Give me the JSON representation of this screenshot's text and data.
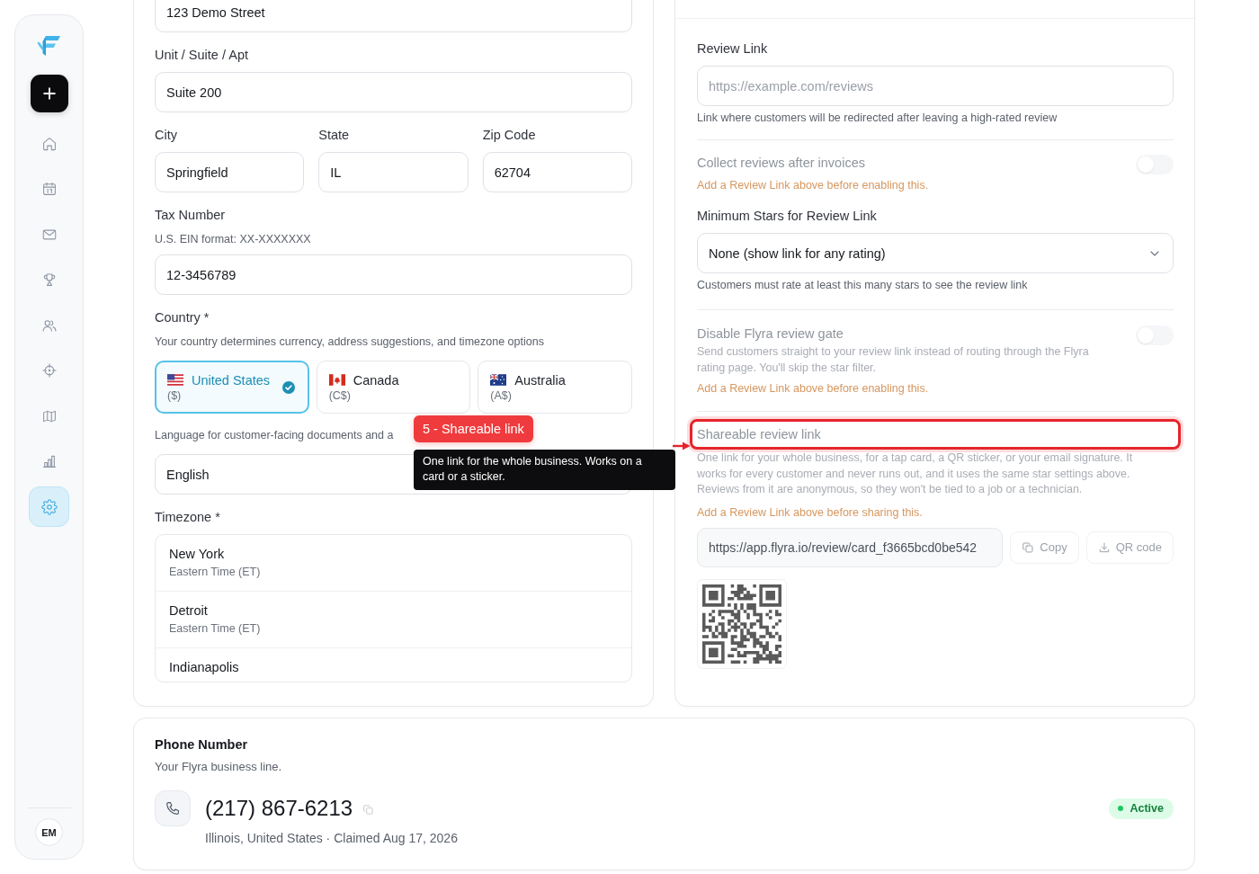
{
  "sidebar": {
    "nav": [
      {
        "selected": false
      },
      {
        "selected": false
      },
      {
        "selected": false
      },
      {
        "selected": false
      },
      {
        "selected": false
      },
      {
        "selected": false
      },
      {
        "selected": false
      },
      {
        "selected": false
      },
      {
        "selected": true
      }
    ],
    "user_initials": "EM"
  },
  "business_details": {
    "street": {
      "value": "123 Demo Street"
    },
    "unit": {
      "label": "Unit / Suite / Apt",
      "value": "Suite 200"
    },
    "address": [
      {
        "label": "City",
        "value": "Springfield"
      },
      {
        "label": "State",
        "value": "IL"
      },
      {
        "label": "Zip Code",
        "value": "62704"
      }
    ],
    "tax_number": {
      "label": "Tax Number",
      "hint": "U.S. EIN format: XX-XXXXXXX",
      "value": "12-3456789"
    },
    "country": {
      "label": "Country *",
      "hint": "Your country determines currency, address suggestions, and timezone options",
      "options": [
        {
          "name": "United States",
          "currency": "($)",
          "selected": true
        },
        {
          "name": "Canada",
          "currency": "(C$)",
          "selected": false
        },
        {
          "name": "Australia",
          "currency": "(A$)",
          "selected": false
        }
      ]
    },
    "language": {
      "hint": "Language for customer-facing documents and a",
      "value": "English"
    },
    "timezone": {
      "label": "Timezone *",
      "options": [
        {
          "city": "New York",
          "zone": "Eastern Time (ET)",
          "selected": false
        },
        {
          "city": "Detroit",
          "zone": "Eastern Time (ET)",
          "selected": false
        },
        {
          "city": "Indianapolis",
          "selected": false
        }
      ]
    }
  },
  "review_settings": {
    "review_link": {
      "label": "Review Link",
      "placeholder": "https://example.com/reviews",
      "hint": "Link where customers will be redirected after leaving a high-rated review"
    },
    "collect_after_invoices": {
      "title": "Collect reviews after invoices",
      "warning": "Add a Review Link above before enabling this.",
      "on": false,
      "disabled": true
    },
    "minimum_stars": {
      "label": "Minimum Stars for Review Link",
      "value": "None (show link for any rating)",
      "hint": "Customers must rate at least this many stars to see the review link"
    },
    "disable_review_gate": {
      "title": "Disable Flyra review gate",
      "description": "Send customers straight to your review link instead of routing through the Flyra rating page. You'll skip the star filter.",
      "warning": "Add a Review Link above before enabling this.",
      "on": false,
      "disabled": true
    },
    "shareable_link": {
      "title": "Shareable review link",
      "highlighted": true,
      "disabled": true,
      "description": "One link for your whole business, for a tap card, a QR sticker, or your email signature. It works for every customer and never runs out, and it uses the same star settings above. Reviews from it are anonymous, so they won't be tied to a job or a technician.",
      "warning": "Add a Review Link above before sharing this.",
      "url": "https://app.flyra.io/review/card_f3665bcd0be542",
      "buttons": [
        {
          "label": "Copy",
          "kind": "copy"
        },
        {
          "label": "QR code",
          "kind": "download"
        }
      ]
    }
  },
  "phone_number": {
    "title": "Phone Number",
    "subtitle": "Your Flyra business line.",
    "number": "(217) 867-6213",
    "details": "Illinois, United States · Claimed Aug 17, 2026",
    "status": "Active"
  },
  "tour": {
    "badge": "5 - Shareable link",
    "tooltip": "One link for the whole business. Works on a card or a sticker."
  }
}
